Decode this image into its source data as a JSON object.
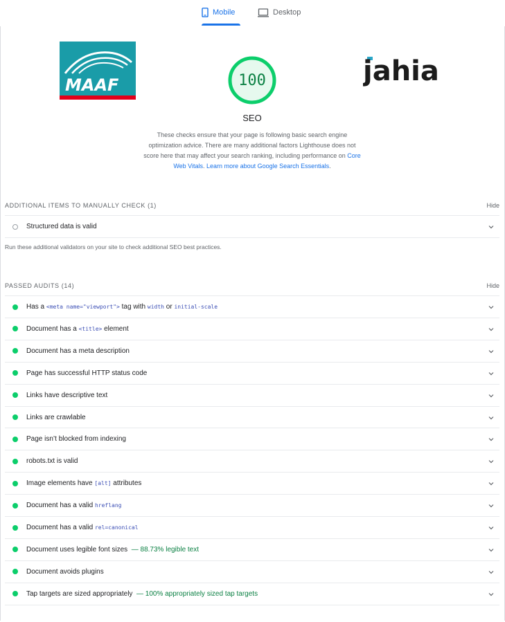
{
  "tabs": {
    "mobile": "Mobile",
    "desktop": "Desktop"
  },
  "colors": {
    "accent": "#1a73e8",
    "pass": "#0cce6b",
    "score_text": "#0b8043",
    "maaf_bg": "#1a9ca8",
    "maaf_stripe": "#e2001a"
  },
  "logos": {
    "maaf": "MAAF",
    "jahia": "jahia"
  },
  "score": {
    "value": "100",
    "title": "SEO",
    "fraction": 1.0
  },
  "description": {
    "text": "These checks ensure that your page is following basic search engine optimization advice. There are many additional factors Lighthouse does not score here that may affect your search ranking, including performance on",
    "link1": "Core Web Vitals",
    "sep": ". ",
    "link2": "Learn more about Google Search Essentials",
    "end": "."
  },
  "manual": {
    "title": "ADDITIONAL ITEMS TO MANUALLY CHECK",
    "count": "(1)",
    "hide": "Hide",
    "item": "Structured data is valid",
    "note": "Run these additional validators on your site to check additional SEO best practices."
  },
  "passed": {
    "title": "PASSED AUDITS",
    "count": "(14)",
    "hide": "Hide",
    "items": [
      {
        "pre": "Has a ",
        "code1": "<meta name=\"viewport\">",
        "mid": " tag with ",
        "code2": "width",
        "mid2": " or ",
        "code3": "initial-scale"
      },
      {
        "pre": "Document has a ",
        "code1": "<title>",
        "post": " element"
      },
      {
        "text": "Document has a meta description"
      },
      {
        "text": "Page has successful HTTP status code"
      },
      {
        "text": "Links have descriptive text"
      },
      {
        "text": "Links are crawlable"
      },
      {
        "text": "Page isn’t blocked from indexing"
      },
      {
        "text": "robots.txt is valid"
      },
      {
        "pre": "Image elements have ",
        "code1": "[alt]",
        "post": " attributes"
      },
      {
        "pre": "Document has a valid ",
        "code1": "hreflang"
      },
      {
        "pre": "Document has a valid ",
        "code1": "rel=canonical"
      },
      {
        "text": "Document uses legible font sizes",
        "extra": "— 88.73% legible text"
      },
      {
        "text": "Document avoids plugins"
      },
      {
        "text": "Tap targets are sized appropriately",
        "extra": "— 100% appropriately sized tap targets"
      }
    ]
  }
}
